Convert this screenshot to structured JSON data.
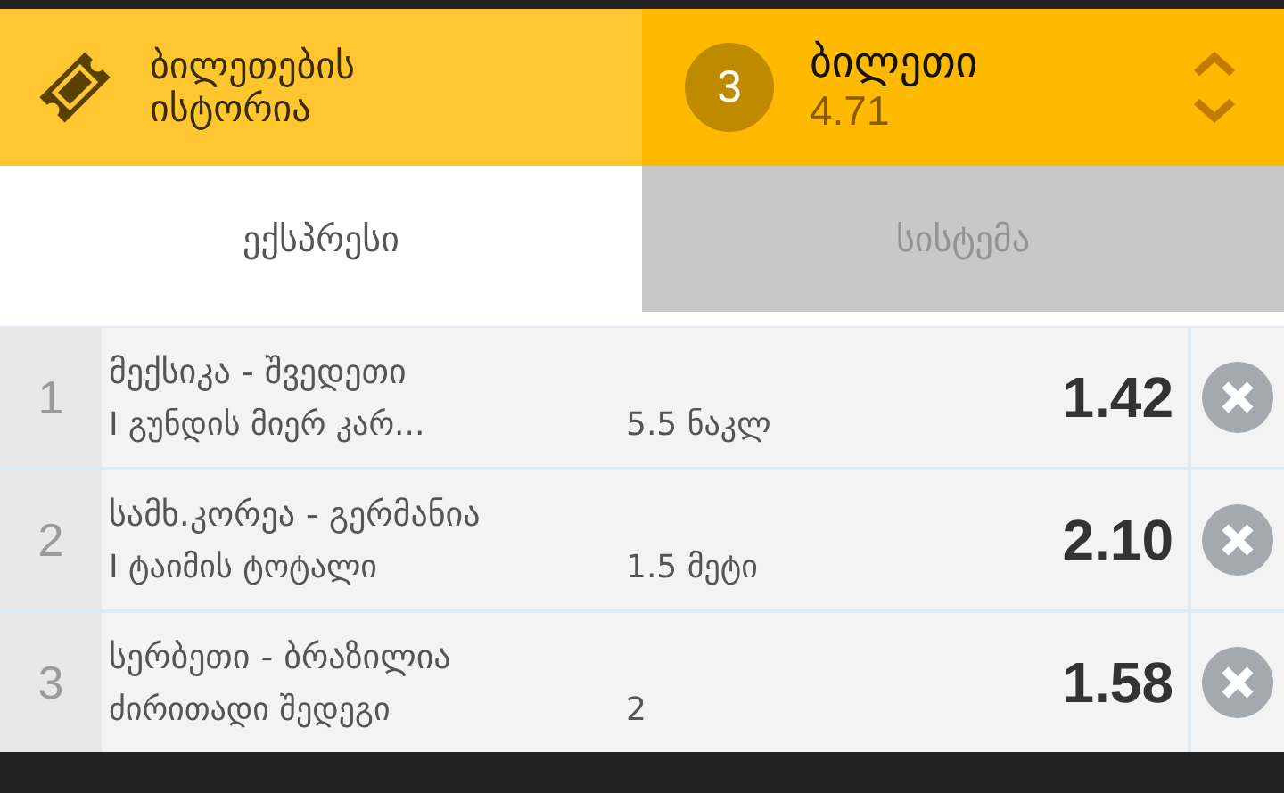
{
  "header": {
    "history": {
      "label": "ბილეთების ისტორია"
    },
    "ticket": {
      "count": "3",
      "title": "ბილეთი",
      "odds": "4.71"
    }
  },
  "tabs": [
    {
      "label": "ექსპრესი",
      "selected": true
    },
    {
      "label": "სისტემა",
      "selected": false
    }
  ],
  "bets": [
    {
      "number": "1",
      "match": "მექსიკა - შვედეთი",
      "market": "I გუნდის მიერ კარ...",
      "pick": "5.5 ნაკლ",
      "odds": "1.42"
    },
    {
      "number": "2",
      "match": "სამხ.კორეა - გერმანია",
      "market": "I ტაიმის ტოტალი",
      "pick": "1.5 მეტი",
      "odds": "2.10"
    },
    {
      "number": "3",
      "match": "სერბეთი - ბრაზილია",
      "market": "ძირითადი შედეგი",
      "pick": "2",
      "odds": "1.58"
    }
  ]
}
